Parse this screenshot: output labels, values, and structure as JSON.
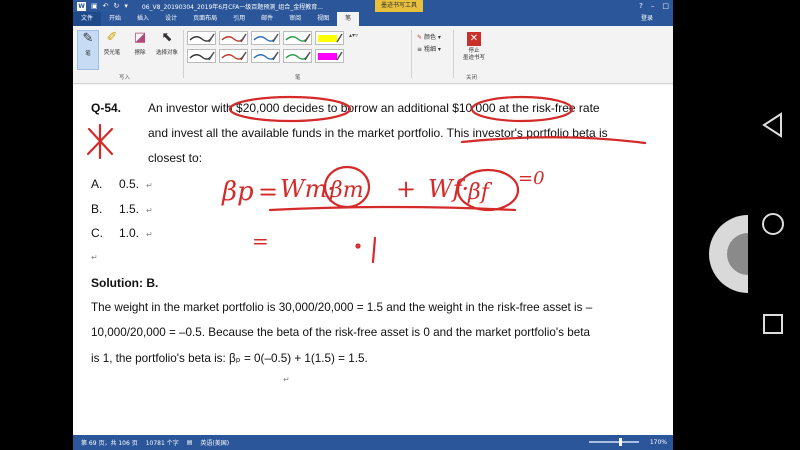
{
  "titlebar": {
    "doc_title": "06_V8_20190304_2019年6月CFA一级百题预测_组合_金程教育...",
    "context_tab": "墨迹书写工具",
    "login": "登录"
  },
  "tabs": [
    "文件",
    "开始",
    "插入",
    "设计",
    "页面布局",
    "引用",
    "邮件",
    "审阅",
    "视图",
    "笔"
  ],
  "ribbon": {
    "pen_label": "笔",
    "highlighter_label": "荧光笔",
    "eraser_label": "擦除",
    "select_label": "选择对象",
    "write_group": "写入",
    "pens_group": "笔",
    "color_label": "颜色",
    "thickness_label": "粗细",
    "stop_label_1": "停止",
    "stop_label_2": "墨迹书写",
    "close_group": "关闭"
  },
  "question": {
    "number": "Q-54.",
    "line1": "An investor with $20,000 decides to borrow an additional $10,000 at the risk-free rate",
    "line2": "and invest all the available funds in the market portfolio. This investor's portfolio beta is",
    "line3": "closest to:",
    "options": [
      {
        "letter": "A.",
        "value": "0.5."
      },
      {
        "letter": "B.",
        "value": "1.5."
      },
      {
        "letter": "C.",
        "value": "1.0."
      }
    ]
  },
  "solution": {
    "heading": "Solution: B.",
    "line1": "The weight in the market portfolio is 30,000/20,000 = 1.5 and the weight in the risk-free asset is –",
    "line2": "10,000/20,000 = –0.5. Because the beta of the risk-free asset is 0 and the market portfolio's beta",
    "line3": "is 1, the portfolio's beta is: βₚ = 0(–0.5) + 1(1.5) = 1.5."
  },
  "handwriting": {
    "beta_p": "βp",
    "equals": "=",
    "wm": "Wm·",
    "beta_m": "βm",
    "plus": "+",
    "wf": "Wf·",
    "beta_f": "βf",
    "eq_zero": "=0",
    "one": "1"
  },
  "statusbar": {
    "page": "第 69 页，共 106 页",
    "words": "10781 个字",
    "lang": "英语(美国)",
    "zoom": "170%"
  },
  "pen_colors": [
    "#333333",
    "#c0392b",
    "#2c6fbb",
    "#2a9d4a",
    "#ffff00",
    "#333333",
    "#c0392b",
    "#2c6fbb",
    "#2a9d4a",
    "#ff00ff"
  ],
  "ink_color": "#d42a2a"
}
